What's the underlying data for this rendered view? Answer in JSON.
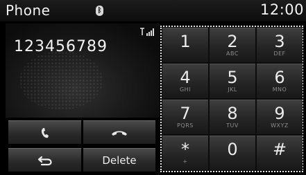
{
  "header": {
    "title": "Phone",
    "bluetooth_icon": "bluetooth-icon",
    "clock": "12:00"
  },
  "display": {
    "number": "123456789",
    "signal_icon": "signal-strength-icon"
  },
  "controls": {
    "call_icon": "phone-call-icon",
    "end_icon": "phone-end-icon",
    "back_icon": "back-arrow-icon",
    "delete_label": "Delete"
  },
  "keypad": {
    "keys": [
      {
        "digit": "1",
        "letters": ""
      },
      {
        "digit": "2",
        "letters": "ABC"
      },
      {
        "digit": "3",
        "letters": "DEF"
      },
      {
        "digit": "4",
        "letters": "GHI"
      },
      {
        "digit": "5",
        "letters": "JKL"
      },
      {
        "digit": "6",
        "letters": "MNO"
      },
      {
        "digit": "7",
        "letters": "PQRS"
      },
      {
        "digit": "8",
        "letters": "TUV"
      },
      {
        "digit": "9",
        "letters": "WXYZ"
      },
      {
        "digit": "*",
        "letters": "+"
      },
      {
        "digit": "0",
        "letters": ""
      },
      {
        "digit": "#",
        "letters": ""
      }
    ]
  },
  "colors": {
    "background": "#000000",
    "text": "#f2f2f2",
    "keypad_border": "#e8e8e8",
    "letters": "#8c8c8c"
  }
}
